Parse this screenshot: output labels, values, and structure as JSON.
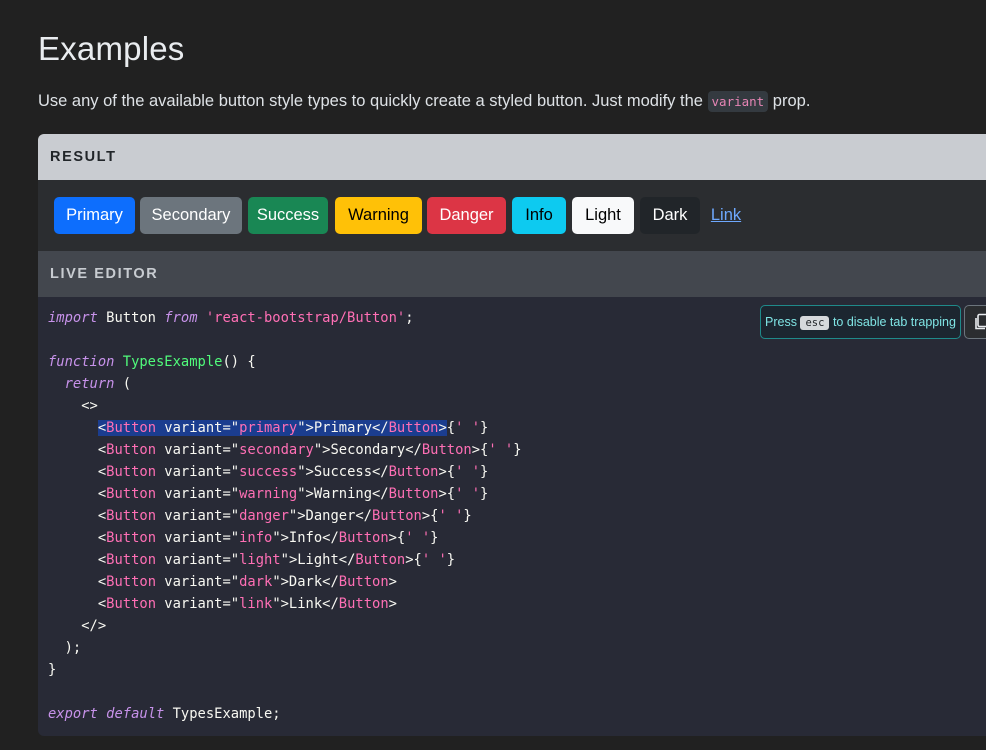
{
  "page": {
    "title": "Examples",
    "intro_before": "Use any of the available button style types to quickly create a styled button. Just modify the ",
    "intro_code": "variant",
    "intro_after": " prop."
  },
  "result": {
    "header": "RESULT",
    "buttons": [
      {
        "label": "Primary",
        "bg": "#0d6efd",
        "fg": "#ffffff"
      },
      {
        "label": "Secondary",
        "bg": "#6c757d",
        "fg": "#ffffff"
      },
      {
        "label": "Success",
        "bg": "#198754",
        "fg": "#ffffff"
      },
      {
        "label": "Warning",
        "bg": "#ffc107",
        "fg": "#000000"
      },
      {
        "label": "Danger",
        "bg": "#dc3545",
        "fg": "#ffffff"
      },
      {
        "label": "Info",
        "bg": "#0dcaf0",
        "fg": "#000000"
      },
      {
        "label": "Light",
        "bg": "#f8f9fa",
        "fg": "#000000"
      },
      {
        "label": "Dark",
        "bg": "#212529",
        "fg": "#ffffff"
      },
      {
        "label": "Link",
        "bg": "transparent",
        "fg": "#6ea8fe"
      }
    ]
  },
  "editor": {
    "header": "LIVE EDITOR",
    "tab_trap_prefix": "Press",
    "tab_trap_key": "esc",
    "tab_trap_suffix": "to disable tab trapping",
    "copy_icon": "copy-icon",
    "code_lines": [
      "import Button from 'react-bootstrap/Button';",
      "",
      "function TypesExample() {",
      "  return (",
      "    <>",
      "      <Button variant=\"primary\">Primary</Button>{' '}",
      "      <Button variant=\"secondary\">Secondary</Button>{' '}",
      "      <Button variant=\"success\">Success</Button>{' '}",
      "      <Button variant=\"warning\">Warning</Button>{' '}",
      "      <Button variant=\"danger\">Danger</Button>{' '}",
      "      <Button variant=\"info\">Info</Button>{' '}",
      "      <Button variant=\"light\">Light</Button>{' '}",
      "      <Button variant=\"dark\">Dark</Button>",
      "      <Button variant=\"link\">Link</Button>",
      "    </>",
      "  );",
      "}",
      "",
      "export default TypesExample;"
    ]
  }
}
